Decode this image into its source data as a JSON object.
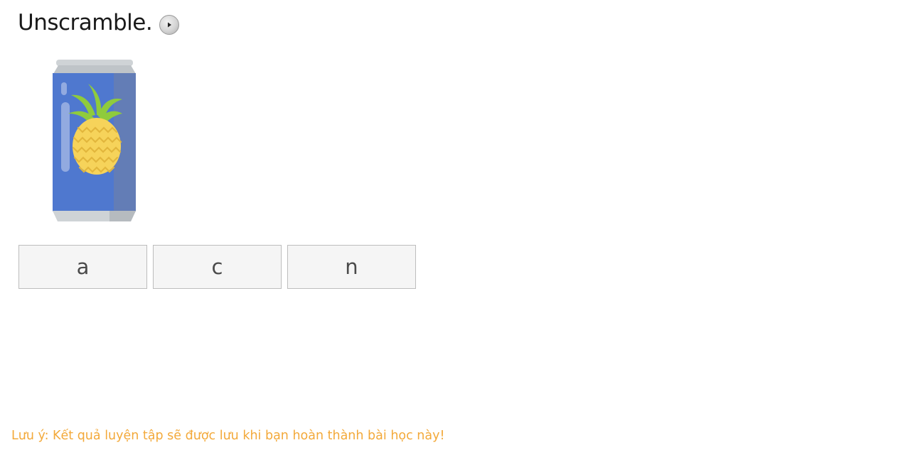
{
  "exercise": {
    "instruction": "Unscramble.",
    "audio_button_icon": "play-circle-icon",
    "picture_icon": "pineapple-juice-can-icon",
    "letter_tiles": [
      {
        "letter": "a"
      },
      {
        "letter": "c"
      },
      {
        "letter": "n"
      }
    ]
  },
  "footer": {
    "note": "Lưu ý: Kết quả luyện tập sẽ được lưu khi bạn hoàn thành bài học này!"
  },
  "colors": {
    "title_text": "#1a1a1a",
    "tile_background": "#f5f5f5",
    "tile_border": "#bdbdbd",
    "note_text": "#f3a93a",
    "can_body": "#4f78cf",
    "can_rim": "#cfd3d6",
    "pineapple": "#f6d35a",
    "pineapple_leaves": "#8fcb3c"
  }
}
